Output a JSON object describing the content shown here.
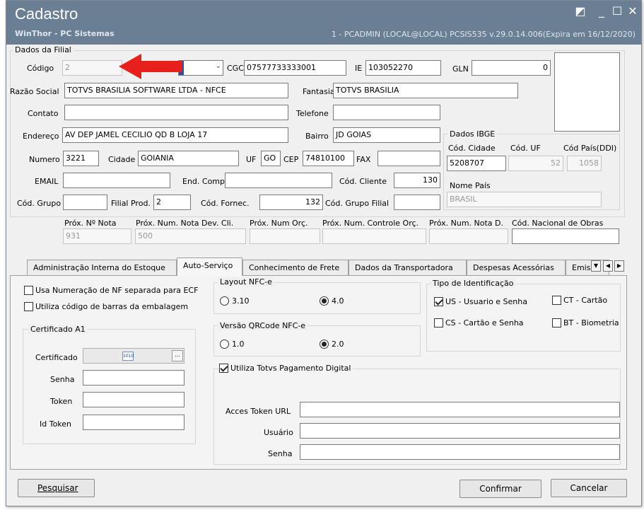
{
  "window": {
    "title": "Cadastro",
    "subtitle": "WinThor - PC Sistemas",
    "sysinfo": "1 - PCADMIN (LOCAL@LOCAL)   PCSIS535  v.29.0.14.006(Expira em 16/12/2020)",
    "min": "_",
    "max": "☐",
    "close": "✕",
    "restore": "◩"
  },
  "filial": {
    "group_title": "Dados da Filial",
    "codigo": {
      "label": "Código",
      "value": "2"
    },
    "cgc": {
      "label": "CGC",
      "value": "07577733333001"
    },
    "ie": {
      "label": "IE",
      "value": "103052270"
    },
    "gln": {
      "label": "GLN",
      "value": "0"
    },
    "razao": {
      "label": "Razão Social",
      "value": "TOTVS BRASILIA SOFTWARE LTDA - NFCE"
    },
    "fantasia": {
      "label": "Fantasia",
      "value": "TOTVS BRASILIA"
    },
    "contato": {
      "label": "Contato",
      "value": ""
    },
    "telefone": {
      "label": "Telefone",
      "value": ""
    },
    "endereco": {
      "label": "Endereço",
      "value": "AV DEP JAMEL CECILIO QD B LOJA 17"
    },
    "bairro": {
      "label": "Bairro",
      "value": "JD GOIAS"
    },
    "numero": {
      "label": "Numero",
      "value": "3221"
    },
    "cidade": {
      "label": "Cidade",
      "value": "GOIANIA"
    },
    "uf": {
      "label": "UF",
      "value": "GO"
    },
    "cep": {
      "label": "CEP",
      "value": "74810100"
    },
    "fax": {
      "label": "FAX",
      "value": ""
    },
    "email": {
      "label": "EMAIL",
      "value": ""
    },
    "endcomp": {
      "label": "End. Comp.",
      "value": ""
    },
    "codcliente": {
      "label": "Cód. Cliente",
      "value": "130"
    },
    "codgrupo": {
      "label": "Cód. Grupo",
      "value": ""
    },
    "filialprod": {
      "label": "Filial Prod.",
      "value": "2"
    },
    "codfornec": {
      "label": "Cód. Fornec.",
      "value": "132"
    },
    "codgrupofilial": {
      "label": "Cód. Grupo Filial",
      "value": ""
    },
    "proxnota": {
      "label": "Próx. Nº Nota",
      "value": "931"
    },
    "proxdev": {
      "label": "Próx. Num. Nota Dev. Cli.",
      "value": "500"
    },
    "proxorc": {
      "label": "Próx. Num Orç.",
      "value": ""
    },
    "proxctrl": {
      "label": "Próx. Num. Controle Orç.",
      "value": ""
    },
    "proxnotad": {
      "label": "Próx. Num. Nota D.",
      "value": ""
    },
    "codobras": {
      "label": "Cód. Nacional de Obras",
      "value": ""
    }
  },
  "ibge": {
    "group_title": "Dados IBGE",
    "codcidade": {
      "label": "Cód. Cidade",
      "value": "5208707"
    },
    "coduf": {
      "label": "Cód. UF",
      "value": "52"
    },
    "codpais": {
      "label": "Cód País(DDI)",
      "value": "1058"
    },
    "nomepais": {
      "label": "Nome País",
      "value": "BRASIL"
    }
  },
  "tabs": [
    "Administração Interna do Estoque",
    "Auto-Serviço",
    "Conhecimento de Frete",
    "Dados da Transportadora",
    "Despesas Acessórias",
    "Emis"
  ],
  "auto": {
    "chk_numeracao": "Usa Numeração de NF separada para ECF",
    "chk_barras": "Utiliza código de barras da embalagem",
    "cert_title": "Certificado A1",
    "cert_label": "Certificado",
    "cert_btn": "...",
    "cert_icon": "1010",
    "senha": "Senha",
    "token": "Token",
    "idtoken": "Id Token",
    "layout_title": "Layout NFC-e",
    "layout_310": "3.10",
    "layout_40": "4.0",
    "qr_title": "Versão QRCode NFC-e",
    "qr_10": "1.0",
    "qr_20": "2.0",
    "tipo_title": "Tipo de Identificação",
    "us": "US - Usuario e Senha",
    "ct": "CT - Cartão",
    "cs": "CS - Cartão e Senha",
    "bt": "BT - Biometria",
    "pag_title": "Utiliza Totvs Pagamento Digital",
    "acces": "Acces Token URL",
    "usuario": "Usuário",
    "senha2": "Senha"
  },
  "buttons": {
    "pesquisar": "Pesquisar",
    "confirmar": "Confirmar",
    "cancelar": "Cancelar"
  },
  "colors": {
    "titlebar": "#6b7f94",
    "arrow": "#e8201c"
  }
}
